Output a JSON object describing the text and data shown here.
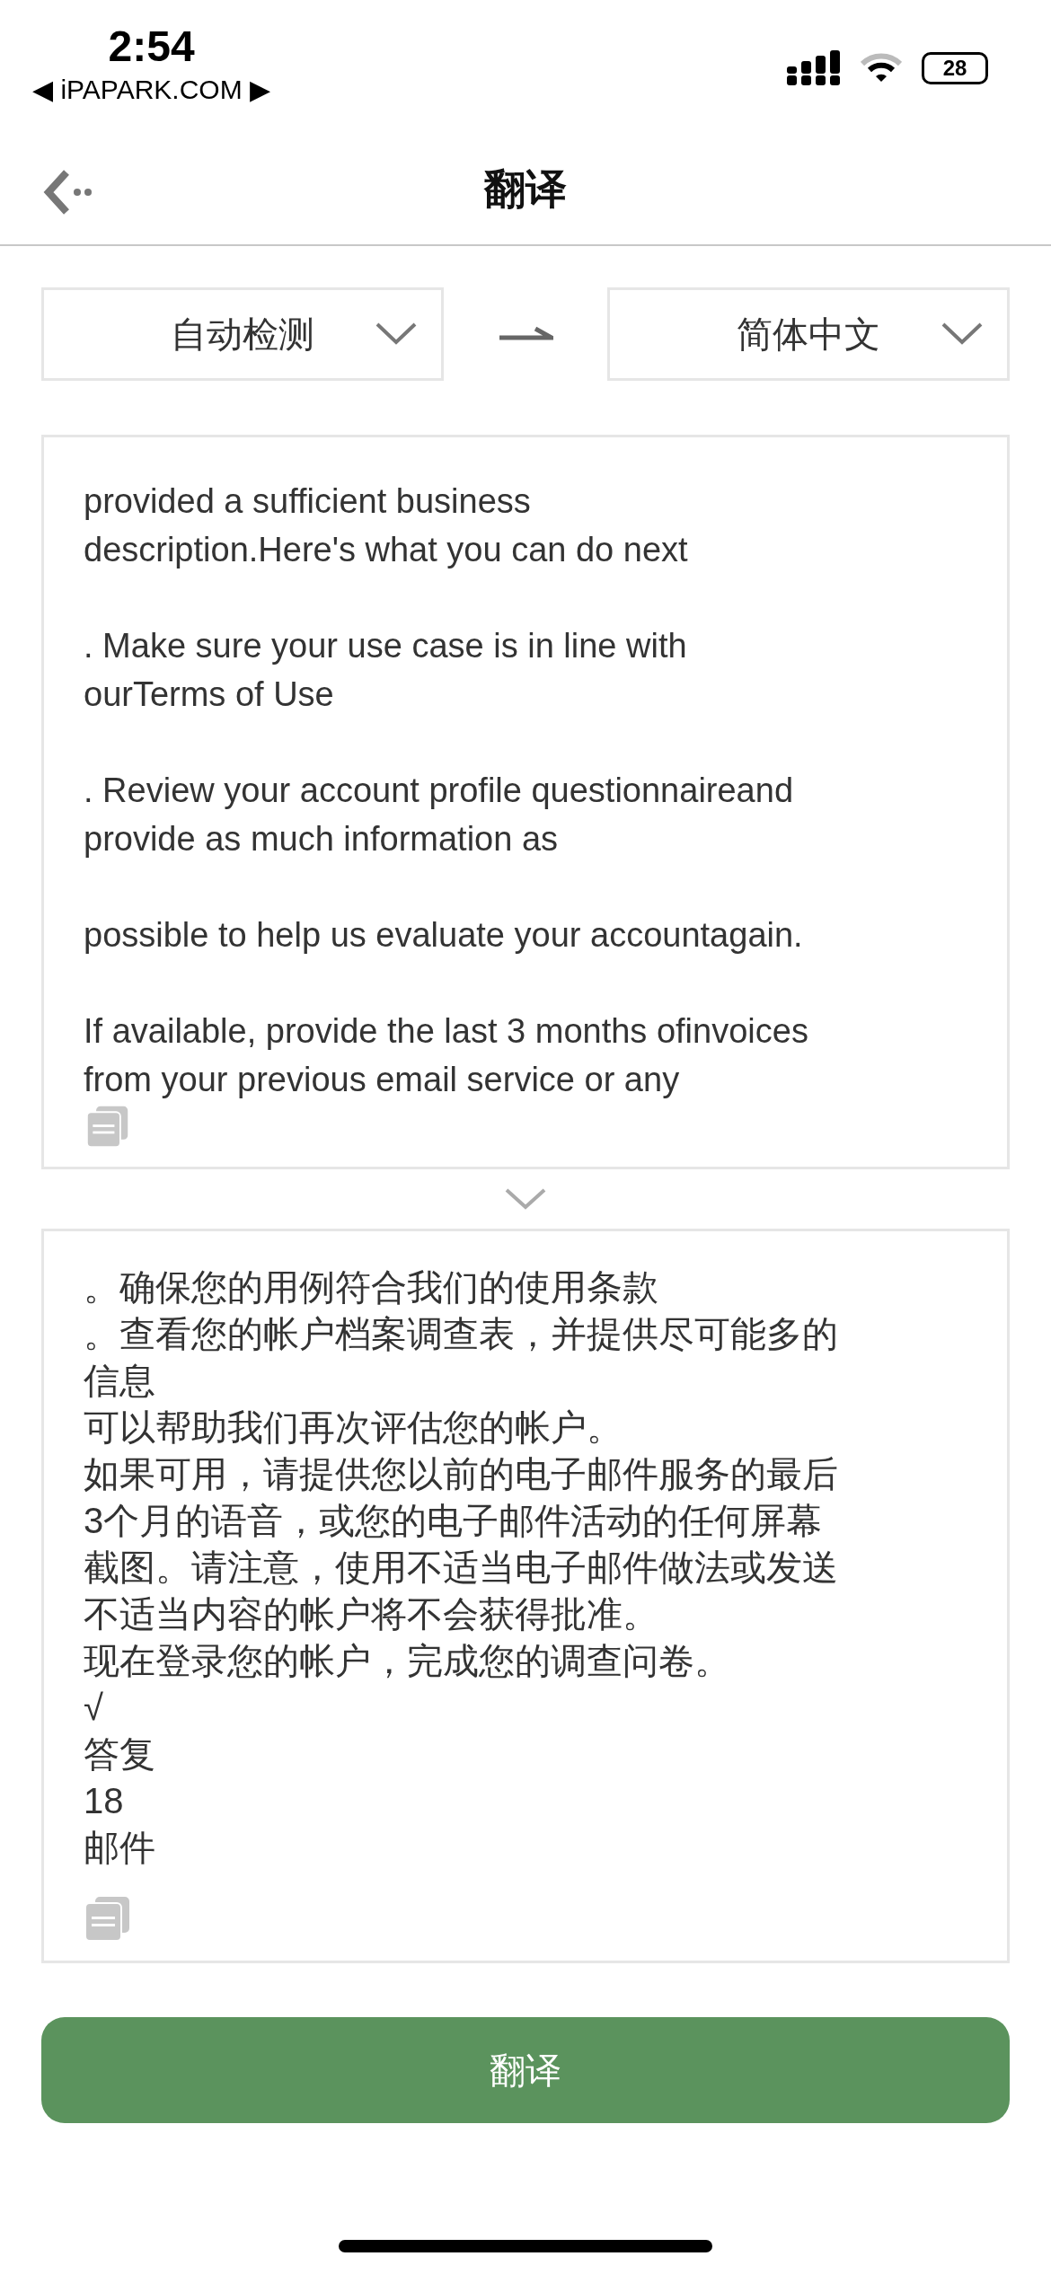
{
  "status_bar": {
    "time": "2:54",
    "back_app": "◀ iPAPARK.COM ▶",
    "battery": "28"
  },
  "nav": {
    "title": "翻译"
  },
  "languages": {
    "source": "自动检测",
    "target": "简体中文"
  },
  "input": {
    "paragraphs": [
      [
        "provided a sufficient business",
        "description.Here's what you can do next"
      ],
      [
        ". Make sure your use case is in line with",
        "ourTerms of Use"
      ],
      [
        ". Review your account profile questionnaireand",
        "provide as much information as"
      ],
      [
        "possible to help us evaluate your accountagain."
      ],
      [
        "If available, provide the last 3 months ofinvoices",
        "from your previous email service or any"
      ]
    ]
  },
  "output": {
    "lines": [
      "。确保您的用例符合我们的使用条款",
      "。查看您的帐户档案调查表，并提供尽可能多的",
      "信息",
      "可以帮助我们再次评估您的帐户。",
      "如果可用，请提供您以前的电子邮件服务的最后",
      "3个月的语音，或您的电子邮件活动的任何屏幕",
      "截图。请注意，使用不适当电子邮件做法或发送",
      "不适当内容的帐户将不会获得批准。",
      "现在登录您的帐户，完成您的调查问卷。",
      "√",
      "答复",
      "18",
      "邮件"
    ]
  },
  "button": {
    "label": "翻译"
  }
}
